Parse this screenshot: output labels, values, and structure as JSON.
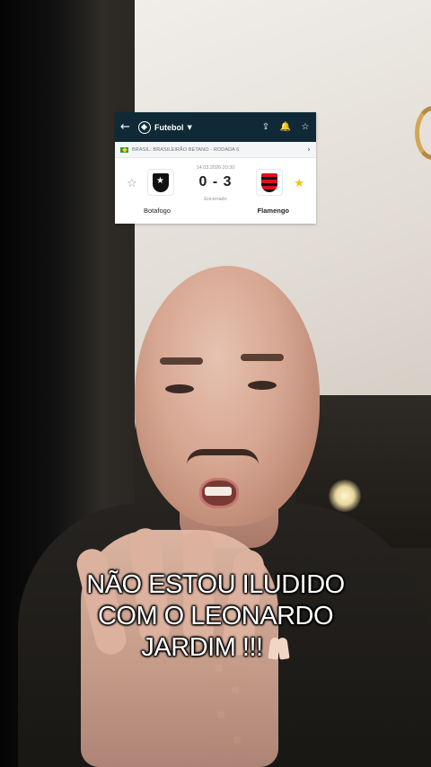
{
  "scorecard": {
    "sport_label": "Futebol",
    "league_line": "BRASIL: BRASILEIRÃO BETANO - RODADA 6",
    "match_date": "14.03.2026 20:30",
    "score": "0 - 3",
    "status": "Encerrado",
    "home_team": "Botafogo",
    "away_team": "Flamengo",
    "home_favorite": false,
    "away_favorite": true,
    "colors": {
      "header_bg": "#0f2a36",
      "favorite_star": "#f3c10f"
    },
    "icons": [
      "back-arrow-icon",
      "football-icon",
      "dropdown-caret-icon",
      "share-icon",
      "notification-bell-icon",
      "favorite-star-icon",
      "brazil-flag-icon",
      "chevron-right-icon"
    ]
  },
  "caption": {
    "line1": "NÃO ESTOU ILUDIDO",
    "line2": "COM O LEONARDO",
    "line3": "JARDIM !!!",
    "emoji": "praying-hands-icon"
  }
}
